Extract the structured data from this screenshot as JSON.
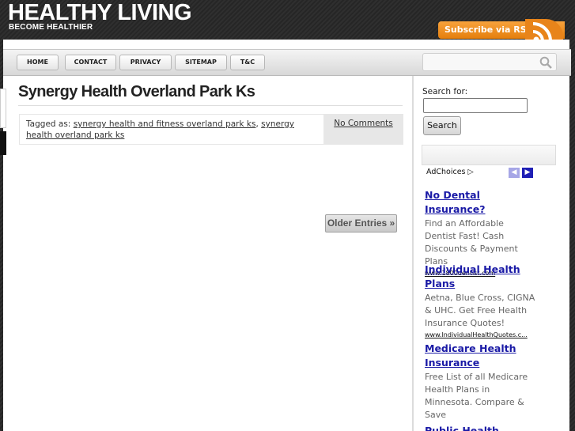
{
  "site": {
    "title": "HEALTHY LIVING",
    "tagline": "BECOME HEALTHIER",
    "rss_label": "Subscribe via RSS"
  },
  "nav": {
    "items": [
      "HOME",
      "CONTACT",
      "PRIVACY",
      "SITEMAP",
      "T&C"
    ]
  },
  "post": {
    "title": "Synergy Health Overland Park Ks",
    "tagged_prefix": "Tagged as:",
    "tags": [
      "synergy health and fitness overland park ks",
      "synergy health overland park ks"
    ],
    "comments": "No Comments"
  },
  "pagination": {
    "older": "Older Entries »"
  },
  "sidebar": {
    "search_label": "Search for:",
    "search_value": "",
    "search_button": "Search",
    "adchoices": "AdChoices",
    "ads": [
      {
        "title": "No Dental Insurance?",
        "body": "Find an Affordable Dentist Fast! Cash Discounts & Payment Plans",
        "url": "www.1800dentist.com"
      },
      {
        "title": "Individual Health Plans",
        "body": "Aetna, Blue Cross, CIGNA & UHC. Get Free Health Insurance Quotes!",
        "url": "www.IndividualHealthQuotes.c..."
      },
      {
        "title": "Medicare Health Insurance",
        "body": "Free List of all Medicare Health Plans in Minnesota. Compare & Save",
        "url": ""
      },
      {
        "title": "Public Health",
        "body": "",
        "url": ""
      }
    ]
  },
  "colors": {
    "rss_orange": "#e8841a",
    "ad_link": "#1a1aa6",
    "background": "#2b2b2b"
  }
}
